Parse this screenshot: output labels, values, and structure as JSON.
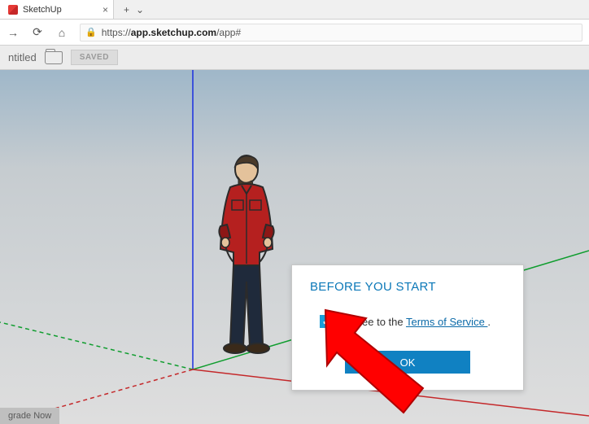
{
  "browser": {
    "tab_title": "SketchUp",
    "url_prefix": "https://",
    "url_host": "app.sketchup.com",
    "url_path": "/app#",
    "nav": {
      "back": "←",
      "forward": "→",
      "refresh": "⟳",
      "home": "⌂"
    }
  },
  "app": {
    "doc_title": "ntitled",
    "saved_label": "SAVED"
  },
  "dialog": {
    "title": "BEFORE YOU START",
    "checkbox_checked": true,
    "agree_prefix": "I agree to the ",
    "tos_link": "Terms of Service ",
    "agree_suffix": ".",
    "ok_label": "OK"
  },
  "footer": {
    "upgrade_label": "grade Now"
  },
  "colors": {
    "axis_blue": "#1a2fe0",
    "axis_green": "#0f9d2e",
    "axis_red": "#c4282a",
    "accent": "#1081c2",
    "checkbox": "#1b9dd9",
    "arrow": "#ff0000"
  }
}
